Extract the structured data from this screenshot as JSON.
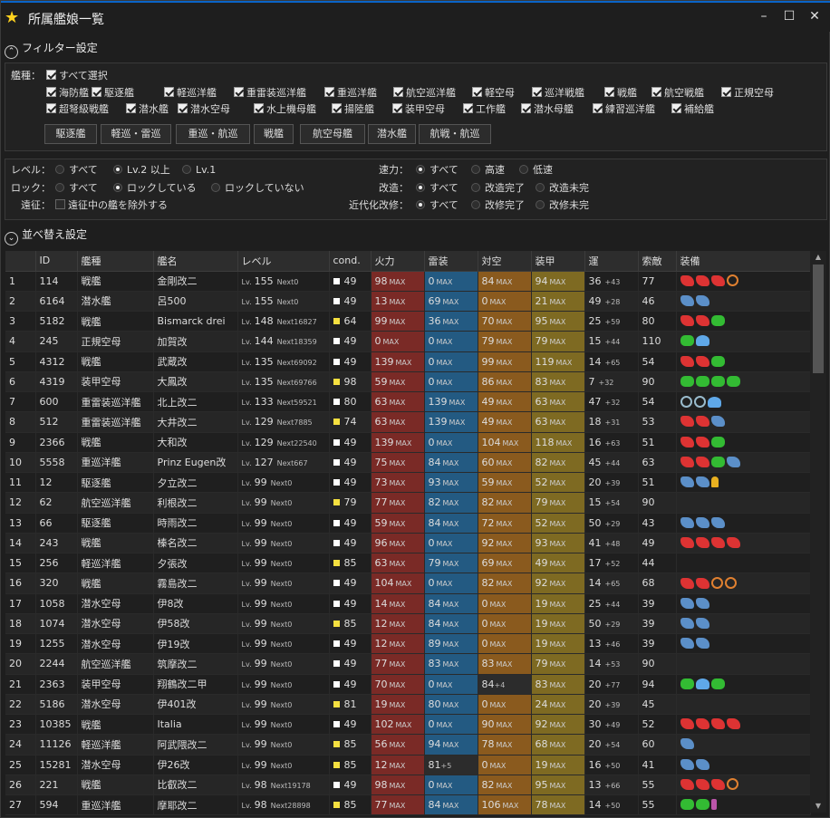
{
  "window": {
    "title": "所属艦娘一覧",
    "minimize": "–",
    "maximize": "☐",
    "close": "✕"
  },
  "filter": {
    "heading": "フィルター設定",
    "ship_type_label": "艦種：",
    "select_all": "すべて選択",
    "types_row1": [
      "海防艦",
      "駆逐艦",
      "軽巡洋艦",
      "重雷装巡洋艦",
      "重巡洋艦",
      "航空巡洋艦",
      "軽空母",
      "巡洋戦艦",
      "戦艦",
      "航空戦艦",
      "正規空母"
    ],
    "types_row2": [
      "超弩級戦艦",
      "潜水艦",
      "潜水空母",
      "水上機母艦",
      "揚陸艦",
      "装甲空母",
      "工作艦",
      "潜水母艦",
      "練習巡洋艦",
      "補給艦"
    ],
    "group_buttons": [
      "駆逐艦",
      "軽巡・雷巡",
      "重巡・航巡",
      "戦艦",
      "航空母艦",
      "潜水艦",
      "航戦・航巡"
    ],
    "level_label": "レベル：",
    "level_opts": [
      "すべて",
      "Lv.2 以上",
      "Lv.1"
    ],
    "lock_label": "ロック：",
    "lock_opts": [
      "すべて",
      "ロックしている",
      "ロックしていない"
    ],
    "expedition_label": "遠征：",
    "expedition_opt": "遠征中の艦を除外する",
    "speed_label": "速力：",
    "speed_opts": [
      "すべて",
      "高速",
      "低速"
    ],
    "remodel_label": "改造：",
    "remodel_opts": [
      "すべて",
      "改造完了",
      "改造未完"
    ],
    "modern_label": "近代化改修：",
    "modern_opts": [
      "すべて",
      "改修完了",
      "改修未完"
    ]
  },
  "sort": {
    "heading": "並べ替え設定"
  },
  "table": {
    "columns": [
      "",
      "ID",
      "艦種",
      "艦名",
      "レベル",
      "cond.",
      "火力",
      "雷装",
      "対空",
      "装甲",
      "運",
      "索敵",
      "装備"
    ],
    "lv_prefix": "Lv.",
    "next_prefix": "Next",
    "max": "MAX",
    "rows": [
      {
        "n": "1",
        "id": "114",
        "type": "戦艦",
        "name": "金剛改二",
        "lv": "155",
        "next": "0",
        "cc": "#ffffff",
        "cond": "49",
        "fire": "98",
        "fm": true,
        "tor": "0",
        "tm": true,
        "aa": "84",
        "am": true,
        "arm": "94",
        "rm": true,
        "luck": "36",
        "lp": "+43",
        "los": "77",
        "eq": "gggr"
      },
      {
        "n": "2",
        "id": "6164",
        "type": "潜水艦",
        "name": "呂500",
        "lv": "155",
        "next": "0",
        "cc": "#ffffff",
        "cond": "49",
        "fire": "13",
        "fm": true,
        "tor": "69",
        "tm": true,
        "aa": "0",
        "am": true,
        "arm": "21",
        "rm": true,
        "luck": "49",
        "lp": "+28",
        "los": "46",
        "eq": "tt"
      },
      {
        "n": "3",
        "id": "5182",
        "type": "戦艦",
        "name": "Bismarck drei",
        "lv": "148",
        "next": "16827",
        "cc": "#f5e040",
        "cond": "64",
        "fire": "99",
        "fm": true,
        "tor": "36",
        "tm": true,
        "aa": "70",
        "am": true,
        "arm": "95",
        "rm": true,
        "luck": "25",
        "lp": "+59",
        "los": "80",
        "eq": "gga"
      },
      {
        "n": "4",
        "id": "245",
        "type": "正規空母",
        "name": "加賀改",
        "lv": "144",
        "next": "18359",
        "cc": "#ffffff",
        "cond": "49",
        "fire": "0",
        "fm": true,
        "tor": "0",
        "tm": true,
        "aa": "79",
        "am": true,
        "arm": "79",
        "rm": true,
        "luck": "15",
        "lp": "+44",
        "los": "110",
        "eq": "ab"
      },
      {
        "n": "5",
        "id": "4312",
        "type": "戦艦",
        "name": "武蔵改",
        "lv": "135",
        "next": "69092",
        "cc": "#ffffff",
        "cond": "49",
        "fire": "139",
        "fm": true,
        "tor": "0",
        "tm": true,
        "aa": "99",
        "am": true,
        "arm": "119",
        "rm": true,
        "luck": "14",
        "lp": "+65",
        "los": "54",
        "eq": "gga"
      },
      {
        "n": "6",
        "id": "4319",
        "type": "装甲空母",
        "name": "大鳳改",
        "lv": "135",
        "next": "69766",
        "cc": "#f5e040",
        "cond": "98",
        "fire": "59",
        "fm": true,
        "tor": "0",
        "tm": true,
        "aa": "86",
        "am": true,
        "arm": "83",
        "rm": true,
        "luck": "7",
        "lp": "+32",
        "los": "90",
        "eq": "aaaa"
      },
      {
        "n": "7",
        "id": "600",
        "type": "重雷装巡洋艦",
        "name": "北上改二",
        "lv": "133",
        "next": "59521",
        "cc": "#ffffff",
        "cond": "80",
        "fire": "63",
        "fm": true,
        "tor": "139",
        "tm": true,
        "aa": "49",
        "am": true,
        "arm": "63",
        "rm": true,
        "luck": "47",
        "lp": "+32",
        "los": "54",
        "eq": "ddb"
      },
      {
        "n": "8",
        "id": "512",
        "type": "重雷装巡洋艦",
        "name": "大井改二",
        "lv": "129",
        "next": "7885",
        "cc": "#f5e040",
        "cond": "74",
        "fire": "63",
        "fm": true,
        "tor": "139",
        "tm": true,
        "aa": "49",
        "am": true,
        "arm": "63",
        "rm": true,
        "luck": "18",
        "lp": "+31",
        "los": "53",
        "eq": "ggt"
      },
      {
        "n": "9",
        "id": "2366",
        "type": "戦艦",
        "name": "大和改",
        "lv": "129",
        "next": "22540",
        "cc": "#ffffff",
        "cond": "49",
        "fire": "139",
        "fm": true,
        "tor": "0",
        "tm": true,
        "aa": "104",
        "am": true,
        "arm": "118",
        "rm": true,
        "luck": "16",
        "lp": "+63",
        "los": "51",
        "eq": "gga"
      },
      {
        "n": "10",
        "id": "5558",
        "type": "重巡洋艦",
        "name": "Prinz Eugen改",
        "lv": "127",
        "next": "667",
        "cc": "#ffffff",
        "cond": "49",
        "fire": "75",
        "fm": true,
        "tor": "84",
        "tm": true,
        "aa": "60",
        "am": true,
        "arm": "82",
        "rm": true,
        "luck": "45",
        "lp": "+44",
        "los": "63",
        "eq": "ggat"
      },
      {
        "n": "11",
        "id": "12",
        "type": "駆逐艦",
        "name": "夕立改二",
        "lv": "99",
        "next": "0",
        "cc": "#ffffff",
        "cond": "49",
        "fire": "73",
        "fm": true,
        "tor": "93",
        "tm": true,
        "aa": "59",
        "am": true,
        "arm": "52",
        "rm": true,
        "luck": "20",
        "lp": "+39",
        "los": "51",
        "eq": "tty"
      },
      {
        "n": "12",
        "id": "62",
        "type": "航空巡洋艦",
        "name": "利根改二",
        "lv": "99",
        "next": "0",
        "cc": "#f5e040",
        "cond": "79",
        "fire": "77",
        "fm": true,
        "tor": "82",
        "tm": true,
        "aa": "82",
        "am": true,
        "arm": "79",
        "rm": true,
        "luck": "15",
        "lp": "+54",
        "los": "90",
        "eq": ""
      },
      {
        "n": "13",
        "id": "66",
        "type": "駆逐艦",
        "name": "時雨改二",
        "lv": "99",
        "next": "0",
        "cc": "#ffffff",
        "cond": "49",
        "fire": "59",
        "fm": true,
        "tor": "84",
        "tm": true,
        "aa": "72",
        "am": true,
        "arm": "52",
        "rm": true,
        "luck": "50",
        "lp": "+29",
        "los": "43",
        "eq": "ttt"
      },
      {
        "n": "14",
        "id": "243",
        "type": "戦艦",
        "name": "榛名改二",
        "lv": "99",
        "next": "0",
        "cc": "#ffffff",
        "cond": "49",
        "fire": "96",
        "fm": true,
        "tor": "0",
        "tm": true,
        "aa": "92",
        "am": true,
        "arm": "93",
        "rm": true,
        "luck": "41",
        "lp": "+48",
        "los": "49",
        "eq": "gggg"
      },
      {
        "n": "15",
        "id": "256",
        "type": "軽巡洋艦",
        "name": "夕張改",
        "lv": "99",
        "next": "0",
        "cc": "#f5e040",
        "cond": "85",
        "fire": "63",
        "fm": true,
        "tor": "79",
        "tm": true,
        "aa": "69",
        "am": true,
        "arm": "49",
        "rm": true,
        "luck": "17",
        "lp": "+52",
        "los": "44",
        "eq": ""
      },
      {
        "n": "16",
        "id": "320",
        "type": "戦艦",
        "name": "霧島改二",
        "lv": "99",
        "next": "0",
        "cc": "#ffffff",
        "cond": "49",
        "fire": "104",
        "fm": true,
        "tor": "0",
        "tm": true,
        "aa": "82",
        "am": true,
        "arm": "92",
        "rm": true,
        "luck": "14",
        "lp": "+65",
        "los": "68",
        "eq": "ggrr"
      },
      {
        "n": "17",
        "id": "1058",
        "type": "潜水空母",
        "name": "伊8改",
        "lv": "99",
        "next": "0",
        "cc": "#ffffff",
        "cond": "49",
        "fire": "14",
        "fm": true,
        "tor": "84",
        "tm": true,
        "aa": "0",
        "am": true,
        "arm": "19",
        "rm": true,
        "luck": "25",
        "lp": "+44",
        "los": "39",
        "eq": "tt"
      },
      {
        "n": "18",
        "id": "1074",
        "type": "潜水空母",
        "name": "伊58改",
        "lv": "99",
        "next": "0",
        "cc": "#f5e040",
        "cond": "85",
        "fire": "12",
        "fm": true,
        "tor": "84",
        "tm": true,
        "aa": "0",
        "am": true,
        "arm": "19",
        "rm": true,
        "luck": "50",
        "lp": "+29",
        "los": "39",
        "eq": "tt"
      },
      {
        "n": "19",
        "id": "1255",
        "type": "潜水空母",
        "name": "伊19改",
        "lv": "99",
        "next": "0",
        "cc": "#ffffff",
        "cond": "49",
        "fire": "12",
        "fm": true,
        "tor": "89",
        "tm": true,
        "aa": "0",
        "am": true,
        "arm": "19",
        "rm": true,
        "luck": "13",
        "lp": "+46",
        "los": "39",
        "eq": "tt"
      },
      {
        "n": "20",
        "id": "2244",
        "type": "航空巡洋艦",
        "name": "筑摩改二",
        "lv": "99",
        "next": "0",
        "cc": "#ffffff",
        "cond": "49",
        "fire": "77",
        "fm": true,
        "tor": "83",
        "tm": true,
        "aa": "83",
        "am": true,
        "arm": "79",
        "rm": true,
        "luck": "14",
        "lp": "+53",
        "los": "90",
        "eq": ""
      },
      {
        "n": "21",
        "id": "2363",
        "type": "装甲空母",
        "name": "翔鶴改二甲",
        "lv": "99",
        "next": "0",
        "cc": "#ffffff",
        "cond": "49",
        "fire": "70",
        "fm": true,
        "tor": "0",
        "tm": true,
        "aa": "84",
        "am": false,
        "ap": "+4",
        "arm": "83",
        "rm": true,
        "luck": "20",
        "lp": "+77",
        "los": "94",
        "eq": "aba"
      },
      {
        "n": "22",
        "id": "5186",
        "type": "潜水空母",
        "name": "伊401改",
        "lv": "99",
        "next": "0",
        "cc": "#f5e040",
        "cond": "81",
        "fire": "19",
        "fm": true,
        "tor": "80",
        "tm": true,
        "aa": "0",
        "am": true,
        "arm": "24",
        "rm": true,
        "luck": "20",
        "lp": "+39",
        "los": "45",
        "eq": ""
      },
      {
        "n": "23",
        "id": "10385",
        "type": "戦艦",
        "name": "Italia",
        "lv": "99",
        "next": "0",
        "cc": "#ffffff",
        "cond": "49",
        "fire": "102",
        "fm": true,
        "tor": "0",
        "tm": true,
        "aa": "90",
        "am": true,
        "arm": "92",
        "rm": true,
        "luck": "30",
        "lp": "+49",
        "los": "52",
        "eq": "gggg"
      },
      {
        "n": "24",
        "id": "11126",
        "type": "軽巡洋艦",
        "name": "阿武隈改二",
        "lv": "99",
        "next": "0",
        "cc": "#f5e040",
        "cond": "85",
        "fire": "56",
        "fm": true,
        "tor": "94",
        "tm": true,
        "aa": "78",
        "am": true,
        "arm": "68",
        "rm": true,
        "luck": "20",
        "lp": "+54",
        "los": "60",
        "eq": "t"
      },
      {
        "n": "25",
        "id": "15281",
        "type": "潜水空母",
        "name": "伊26改",
        "lv": "99",
        "next": "0",
        "cc": "#f5e040",
        "cond": "85",
        "fire": "12",
        "fm": true,
        "tor": "81",
        "tm": false,
        "tp": "+5",
        "aa": "0",
        "am": true,
        "arm": "19",
        "rm": true,
        "luck": "16",
        "lp": "+50",
        "los": "41",
        "eq": "tt"
      },
      {
        "n": "26",
        "id": "221",
        "type": "戦艦",
        "name": "比叡改二",
        "lv": "98",
        "next": "19178",
        "cc": "#ffffff",
        "cond": "49",
        "fire": "98",
        "fm": true,
        "tor": "0",
        "tm": true,
        "aa": "82",
        "am": true,
        "arm": "95",
        "rm": true,
        "luck": "13",
        "lp": "+66",
        "los": "55",
        "eq": "gggr"
      },
      {
        "n": "27",
        "id": "594",
        "type": "重巡洋艦",
        "name": "摩耶改二",
        "lv": "98",
        "next": "28898",
        "cc": "#f5e040",
        "cond": "85",
        "fire": "77",
        "fm": true,
        "tor": "84",
        "tm": true,
        "aa": "106",
        "am": true,
        "arm": "78",
        "rm": true,
        "luck": "14",
        "lp": "+50",
        "los": "55",
        "eq": "aap"
      }
    ]
  }
}
